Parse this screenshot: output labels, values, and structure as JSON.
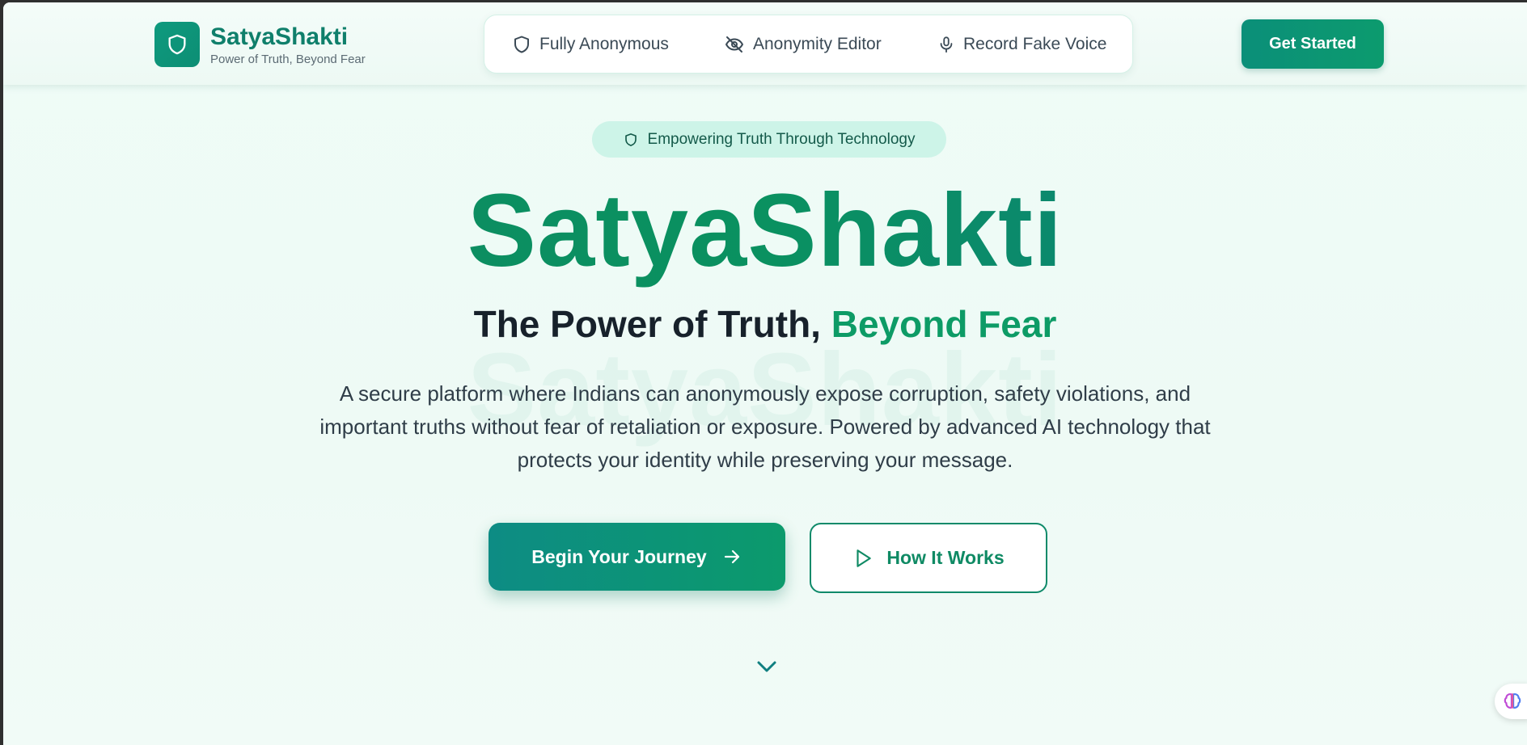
{
  "header": {
    "brand_name": "SatyaShakti",
    "brand_tagline": "Power of Truth, Beyond Fear",
    "nav": [
      {
        "label": "Fully Anonymous",
        "icon": "shield-icon"
      },
      {
        "label": "Anonymity Editor",
        "icon": "eye-off-icon"
      },
      {
        "label": "Record Fake Voice",
        "icon": "microphone-icon"
      }
    ],
    "cta_label": "Get Started"
  },
  "hero": {
    "badge": "Empowering Truth Through Technology",
    "title": "SatyaShakti",
    "subtitle_main": "The Power of Truth, ",
    "subtitle_accent": "Beyond Fear",
    "description": "A secure platform where Indians can anonymously expose corruption, safety violations, and important truths without fear of retaliation or exposure. Powered by advanced AI technology that protects your identity while preserving your message.",
    "primary_button": "Begin Your Journey",
    "secondary_button": "How It Works"
  },
  "colors": {
    "brand": "#0f7f6b",
    "accent": "#0d9b66",
    "badge_bg": "#cdf4e8",
    "page_bg": "#effcf7"
  },
  "icons": {
    "logo": "shield-icon",
    "badge": "shield-icon",
    "primary_button": "arrow-right-icon",
    "secondary_button": "play-icon",
    "scroll": "chevron-down-icon",
    "widget": "brain-icon"
  }
}
